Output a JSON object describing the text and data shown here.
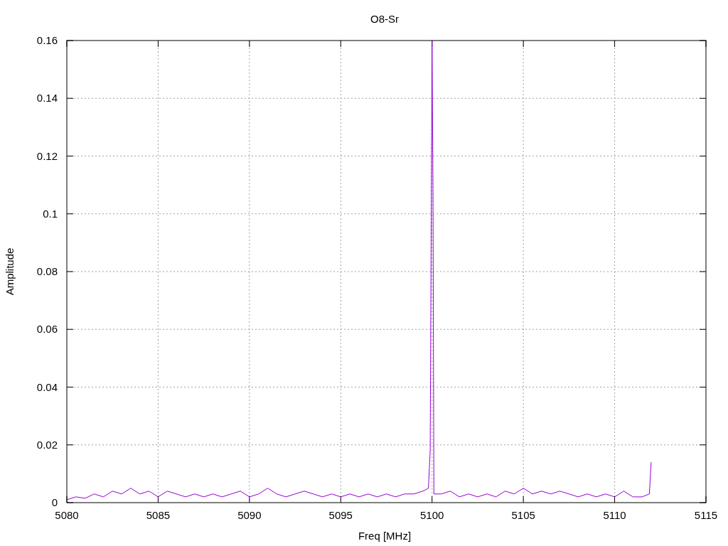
{
  "chart_data": {
    "type": "line",
    "title": "O8-Sr",
    "xlabel": "Freq [MHz]",
    "ylabel": "Amplitude",
    "x": [
      5080,
      5080.5,
      5081,
      5081.5,
      5082,
      5082.5,
      5083,
      5083.5,
      5084,
      5084.5,
      5085,
      5085.5,
      5086,
      5086.5,
      5087,
      5087.5,
      5088,
      5088.5,
      5089,
      5089.5,
      5090,
      5090.5,
      5091,
      5091.5,
      5092,
      5092.5,
      5093,
      5093.5,
      5094,
      5094.5,
      5095,
      5095.5,
      5096,
      5096.5,
      5097,
      5097.5,
      5098,
      5098.5,
      5099,
      5099.5,
      5099.8,
      5099.9,
      5100,
      5100.05,
      5100.1,
      5100.5,
      5101,
      5101.5,
      5102,
      5102.5,
      5103,
      5103.5,
      5104,
      5104.5,
      5105,
      5105.5,
      5106,
      5106.5,
      5107,
      5107.5,
      5108,
      5108.5,
      5109,
      5109.5,
      5110,
      5110.5,
      5111,
      5111.5,
      5111.9,
      5112
    ],
    "series": [
      {
        "color": "#9400d3",
        "values": [
          0.001,
          0.002,
          0.0015,
          0.003,
          0.002,
          0.004,
          0.003,
          0.005,
          0.003,
          0.004,
          0.002,
          0.004,
          0.003,
          0.002,
          0.003,
          0.002,
          0.003,
          0.002,
          0.003,
          0.004,
          0.002,
          0.003,
          0.005,
          0.003,
          0.002,
          0.003,
          0.004,
          0.003,
          0.002,
          0.003,
          0.002,
          0.003,
          0.002,
          0.003,
          0.002,
          0.003,
          0.002,
          0.003,
          0.003,
          0.004,
          0.005,
          0.018,
          0.16,
          0.11,
          0.003,
          0.003,
          0.004,
          0.002,
          0.003,
          0.002,
          0.003,
          0.002,
          0.004,
          0.003,
          0.005,
          0.003,
          0.004,
          0.003,
          0.004,
          0.003,
          0.002,
          0.003,
          0.002,
          0.003,
          0.002,
          0.004,
          0.002,
          0.002,
          0.003,
          0.014
        ]
      }
    ],
    "grid": true,
    "xlim": [
      5080,
      5115
    ],
    "ylim": [
      0,
      0.16
    ],
    "xticks": [
      5080,
      5085,
      5090,
      5095,
      5100,
      5105,
      5110,
      5115
    ],
    "yticks": [
      0,
      0.02,
      0.04,
      0.06,
      0.08,
      0.1,
      0.12,
      0.14,
      0.16
    ]
  }
}
